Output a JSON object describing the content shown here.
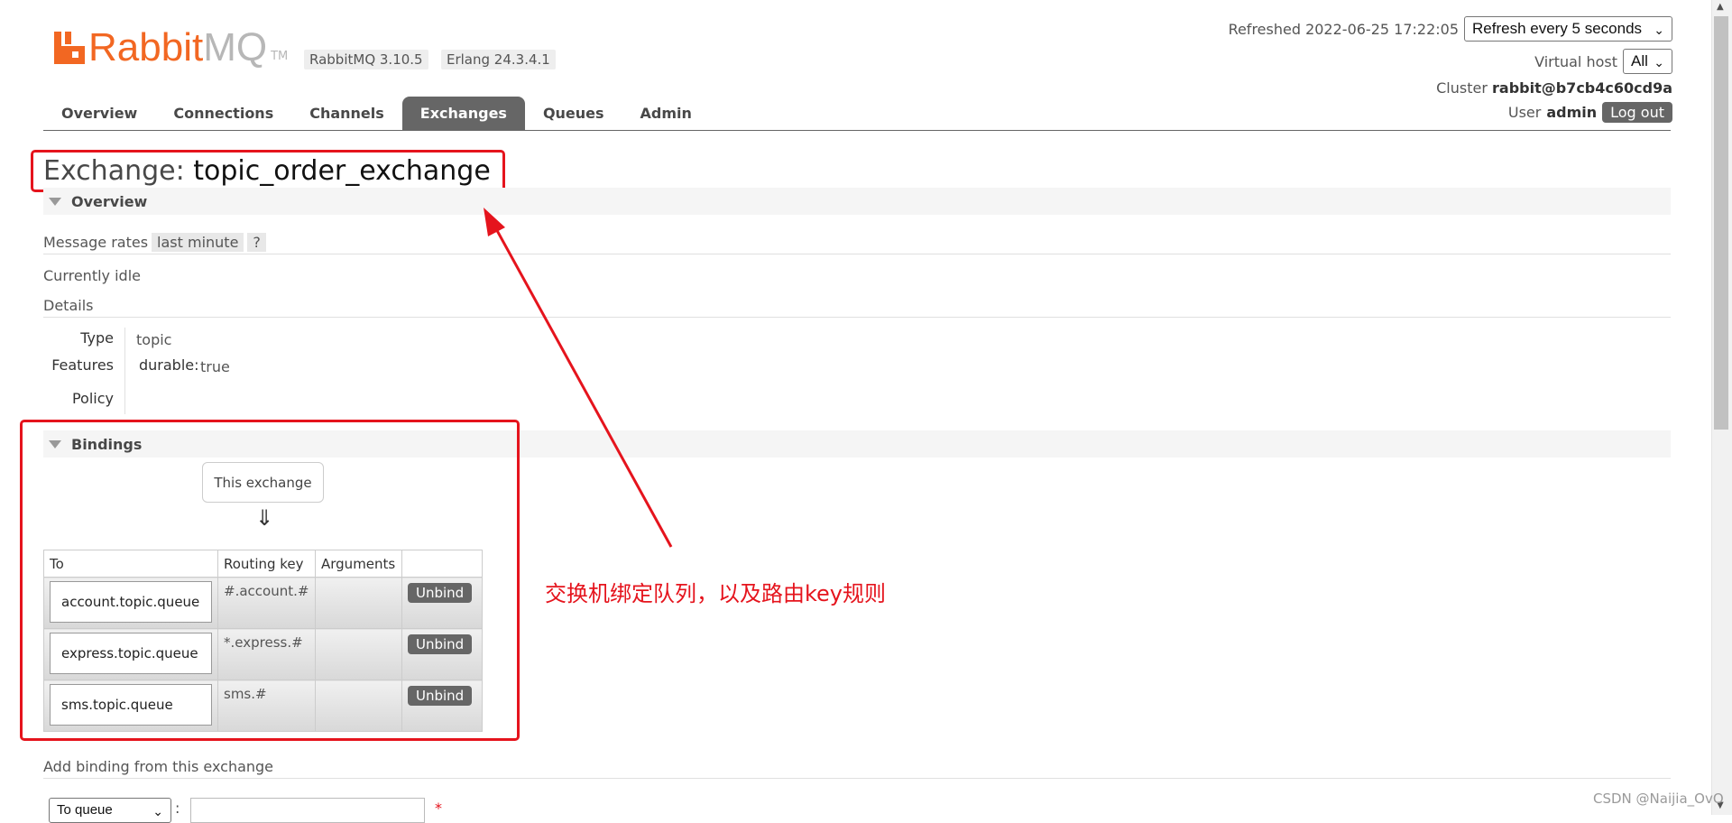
{
  "header": {
    "logo_text_rabbit": "Rabbit",
    "logo_text_mq": "MQ",
    "logo_tm": "TM",
    "rabbitmq_version": "RabbitMQ 3.10.5",
    "erlang_version": "Erlang 24.3.4.1",
    "refreshed_label": "Refreshed 2022-06-25 17:22:05",
    "refresh_select": "Refresh every 5 seconds",
    "virtual_host_label": "Virtual host",
    "virtual_host_select": "All",
    "cluster_label": "Cluster",
    "cluster_name": "rabbit@b7cb4c60cd9a",
    "user_label": "User",
    "user_name": "admin",
    "logout_label": "Log out"
  },
  "nav": {
    "tabs": [
      {
        "label": "Overview"
      },
      {
        "label": "Connections"
      },
      {
        "label": "Channels"
      },
      {
        "label": "Exchanges"
      },
      {
        "label": "Queues"
      },
      {
        "label": "Admin"
      }
    ],
    "active_tab": "Exchanges"
  },
  "page": {
    "title_prefix": "Exchange:",
    "exchange_name": "topic_order_exchange"
  },
  "overview": {
    "section_label": "Overview",
    "message_rates_label": "Message rates",
    "message_rates_range": "last minute",
    "help_label": "?",
    "idle_text": "Currently idle",
    "details_label": "Details",
    "type_key": "Type",
    "type_value": "topic",
    "features_key": "Features",
    "durable_key": "durable:",
    "durable_value": "true",
    "policy_key": "Policy"
  },
  "bindings": {
    "section_label": "Bindings",
    "this_exchange_label": "This exchange",
    "arrow": "⇓",
    "columns": {
      "to": "To",
      "routing_key": "Routing key",
      "arguments": "Arguments"
    },
    "rows": [
      {
        "to": "account.topic.queue",
        "routing_key": "#.account.#",
        "arguments": "",
        "action": "Unbind"
      },
      {
        "to": "express.topic.queue",
        "routing_key": "*.express.#",
        "arguments": "",
        "action": "Unbind"
      },
      {
        "to": "sms.topic.queue",
        "routing_key": "sms.#",
        "arguments": "",
        "action": "Unbind"
      }
    ]
  },
  "add_binding": {
    "label": "Add binding from this exchange",
    "destination_type": "To queue",
    "colon": ":",
    "required_marker": "*"
  },
  "annotation": {
    "text": "交换机绑定队列，以及路由key规则",
    "color": "#e5141d"
  },
  "watermark": "CSDN @Naijia_OvO",
  "colors": {
    "brand": "#f26722",
    "active_tab": "#666666",
    "annotation": "#e5141d"
  }
}
